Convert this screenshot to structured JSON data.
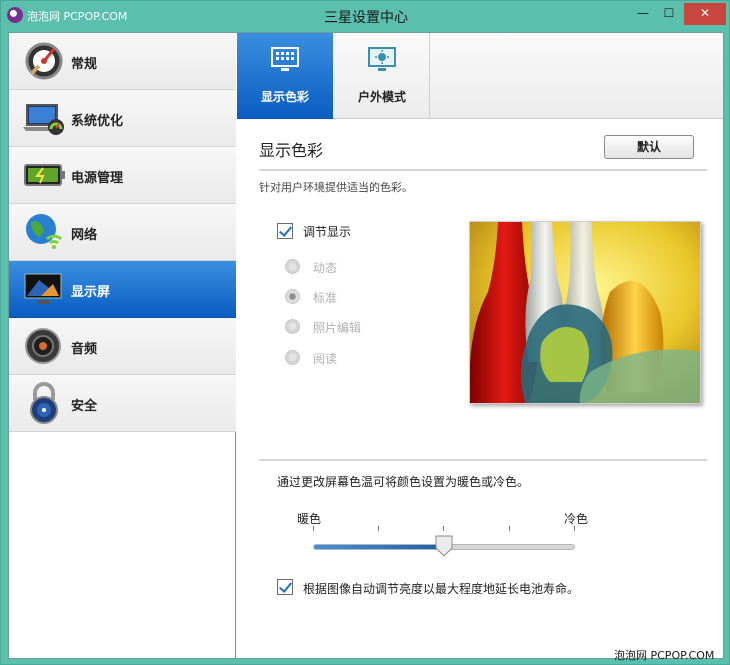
{
  "window": {
    "title": "三星设置中心",
    "watermark_top": "泡泡网 PCPOP.COM",
    "watermark_bottom": "泡泡网 PCPOP.COM",
    "controls": {
      "minimize": "—",
      "maximize": "☐",
      "close": "✕"
    }
  },
  "sidebar": {
    "items": [
      {
        "label": "常规",
        "icon": "settings-gauge-icon",
        "active": false
      },
      {
        "label": "系统优化",
        "icon": "laptop-icon",
        "active": false
      },
      {
        "label": "电源管理",
        "icon": "battery-icon",
        "active": false
      },
      {
        "label": "网络",
        "icon": "globe-wifi-icon",
        "active": false
      },
      {
        "label": "显示屏",
        "icon": "monitor-icon",
        "active": true
      },
      {
        "label": "音频",
        "icon": "speaker-icon",
        "active": false
      },
      {
        "label": "安全",
        "icon": "padlock-icon",
        "active": false
      }
    ]
  },
  "tabs": [
    {
      "label": "显示色彩",
      "icon": "display-color-icon",
      "active": true
    },
    {
      "label": "户外模式",
      "icon": "outdoor-mode-icon",
      "active": false
    }
  ],
  "content": {
    "section_title": "显示色彩",
    "default_button": "默认",
    "description": "针对用户环境提供适当的色彩。",
    "adjust_display": {
      "label": "调节显示",
      "checked": true
    },
    "modes": [
      {
        "label": "动态",
        "selected": false
      },
      {
        "label": "标准",
        "selected": true
      },
      {
        "label": "照片编辑",
        "selected": false
      },
      {
        "label": "阅读",
        "selected": false
      }
    ],
    "preview_icon": "glass-vases-image",
    "temperature_description": "通过更改屏幕色温可将颜色设置为暖色或冷色。",
    "slider": {
      "warm_label": "暖色",
      "cool_label": "冷色",
      "value": 0.5
    },
    "auto_brightness": {
      "label": "根据图像自动调节亮度以最大程度地延长电池寿命。",
      "checked": true
    }
  }
}
